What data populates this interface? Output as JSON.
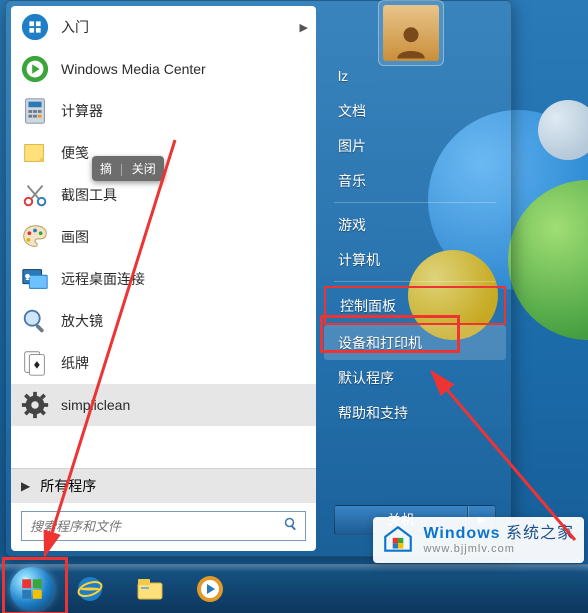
{
  "left_programs": [
    {
      "name": "getting-started",
      "label": "入门",
      "has_submenu": true,
      "icon": "assist"
    },
    {
      "name": "windows-media-center",
      "label": "Windows Media Center",
      "icon": "media-center"
    },
    {
      "name": "calculator",
      "label": "计算器",
      "icon": "calculator"
    },
    {
      "name": "sticky-notes",
      "label": "便笺",
      "icon": "sticky"
    },
    {
      "name": "snipping-tool",
      "label": "截图工具",
      "icon": "scissors"
    },
    {
      "name": "paint",
      "label": "画图",
      "icon": "palette"
    },
    {
      "name": "remote-desktop",
      "label": "远程桌面连接",
      "icon": "remote"
    },
    {
      "name": "magnifier",
      "label": "放大镜",
      "icon": "magnifier"
    },
    {
      "name": "solitaire",
      "label": "纸牌",
      "icon": "solitaire"
    },
    {
      "name": "simpliclean",
      "label": "simpliclean",
      "icon": "gear",
      "highlight_gray": true
    }
  ],
  "all_programs_label": "所有程序",
  "search_placeholder": "搜索程序和文件",
  "tooltip": {
    "left": "摘",
    "right": "关闭"
  },
  "right_items": [
    {
      "name": "user-lz",
      "label": "lz"
    },
    {
      "name": "documents",
      "label": "文档"
    },
    {
      "name": "pictures",
      "label": "图片"
    },
    {
      "name": "music",
      "label": "音乐"
    },
    {
      "separator": true
    },
    {
      "name": "games",
      "label": "游戏"
    },
    {
      "name": "computer",
      "label": "计算机"
    },
    {
      "separator": true
    },
    {
      "name": "control-panel",
      "label": "控制面板",
      "boxed": true
    },
    {
      "name": "devices-printers",
      "label": "设备和打印机",
      "hovered": true
    },
    {
      "name": "default-programs",
      "label": "默认程序"
    },
    {
      "name": "help-support",
      "label": "帮助和支持"
    }
  ],
  "shutdown_label": "关机",
  "watermark": {
    "brand_prefix": "Windows",
    "brand_suffix": " 系统之家",
    "url": "www.bjjmlv.com"
  }
}
